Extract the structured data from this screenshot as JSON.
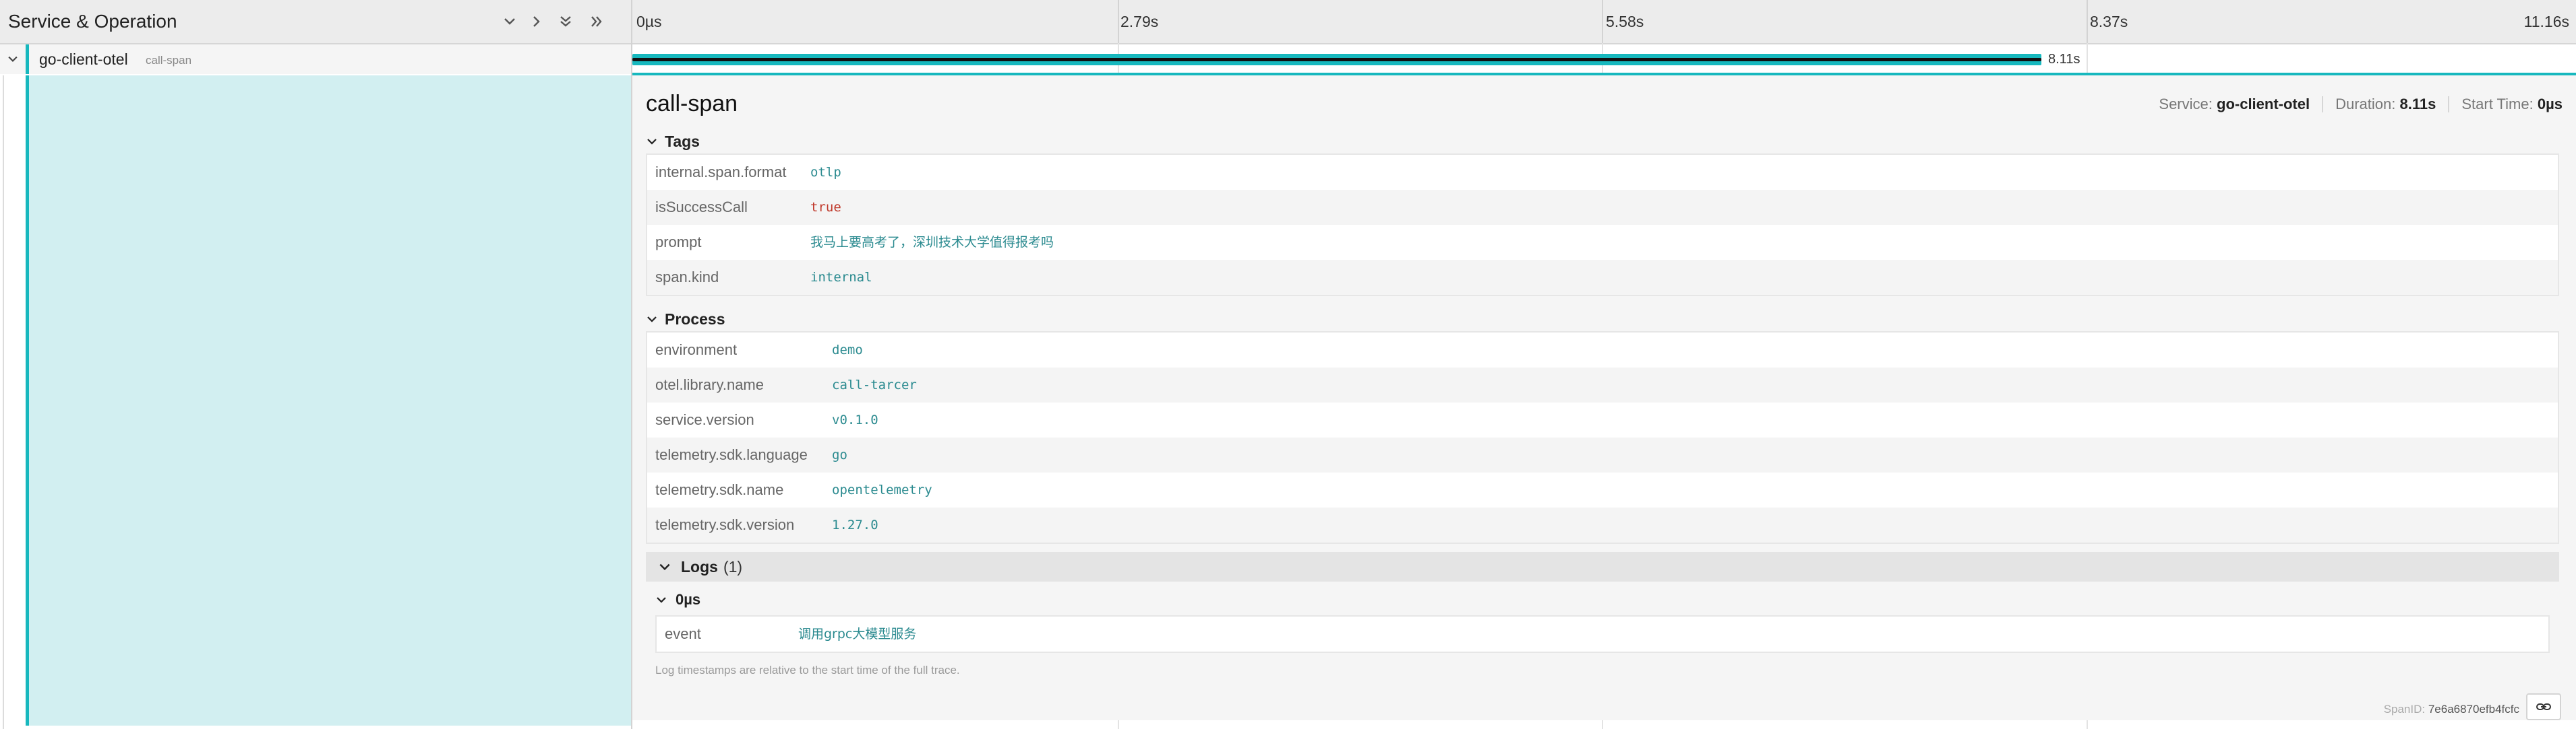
{
  "header": {
    "title": "Service & Operation",
    "buttons": [
      {
        "icon": "chevron-down-icon",
        "action": "expand-one"
      },
      {
        "icon": "chevron-right-icon",
        "action": "collapse-one"
      },
      {
        "icon": "double-chevron-down-icon",
        "action": "expand-all"
      },
      {
        "icon": "double-chevron-right-icon",
        "action": "collapse-all"
      }
    ],
    "ticks": [
      "0µs",
      "2.79s",
      "5.58s",
      "8.37s",
      "11.16s"
    ]
  },
  "span_row": {
    "service": "go-client-otel",
    "operation": "call-span",
    "duration_label": "8.11s",
    "accent_color": "#17b8be"
  },
  "detail": {
    "title": "call-span",
    "meta": {
      "service_label": "Service:",
      "service_value": "go-client-otel",
      "duration_label": "Duration:",
      "duration_value": "8.11s",
      "start_label": "Start Time:",
      "start_value": "0µs"
    },
    "tags": {
      "label": "Tags",
      "rows": [
        {
          "key": "internal.span.format",
          "value": "otlp"
        },
        {
          "key": "isSuccessCall",
          "value": "true"
        },
        {
          "key": "prompt",
          "value": "我马上要高考了，深圳技术大学值得报考吗"
        },
        {
          "key": "span.kind",
          "value": "internal"
        }
      ]
    },
    "process": {
      "label": "Process",
      "rows": [
        {
          "key": "environment",
          "value": "demo"
        },
        {
          "key": "otel.library.name",
          "value": "call-tarcer"
        },
        {
          "key": "service.version",
          "value": "v0.1.0"
        },
        {
          "key": "telemetry.sdk.language",
          "value": "go"
        },
        {
          "key": "telemetry.sdk.name",
          "value": "opentelemetry"
        },
        {
          "key": "telemetry.sdk.version",
          "value": "1.27.0"
        }
      ]
    },
    "logs": {
      "label": "Logs",
      "count": "(1)",
      "entry_time": "0µs",
      "entry_key": "event",
      "entry_value": "调用grpc大模型服务",
      "note": "Log timestamps are relative to the start time of the full trace."
    },
    "span_id_label": "SpanID:",
    "span_id_value": "7e6a6870efb4fcfc"
  }
}
